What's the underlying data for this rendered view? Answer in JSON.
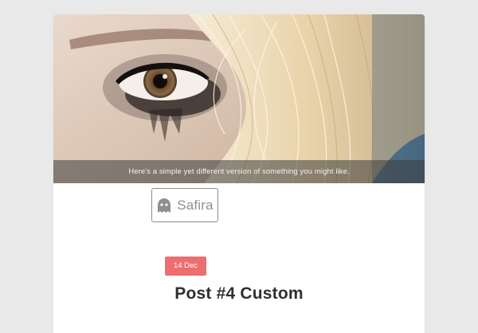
{
  "hero": {
    "caption": "Here's a simple yet different version of something you might like."
  },
  "logo": {
    "text": "Safira",
    "icon": "ghost-icon"
  },
  "post": {
    "date": "14 Dec",
    "title": "Post #4 Custom"
  },
  "colors": {
    "page_background": "#e9e9e9",
    "card_background": "#ffffff",
    "date_badge": "#ee6e6f",
    "title_text": "#2f2f2f",
    "logo_border": "#8c8c8c"
  }
}
